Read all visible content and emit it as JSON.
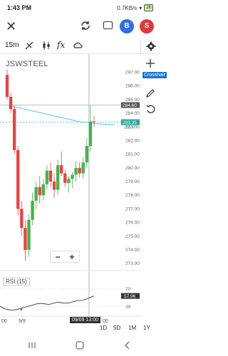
{
  "status": {
    "time": "1:43 PM",
    "net_speed": "0.7KB/s",
    "battery": "26"
  },
  "app_bar": {
    "avatar_b": "B",
    "avatar_s": "S"
  },
  "toolbar": {
    "interval": "15m"
  },
  "tooltip": {
    "crosshair": "Crosshair"
  },
  "chart": {
    "symbol": "JSWSTEEL",
    "price_axis": [
      "287.00",
      "286.00",
      "285.00",
      "284.00",
      "283.00",
      "282.00",
      "281.00",
      "280.00",
      "279.00",
      "278.00",
      "277.00",
      "276.00",
      "275.00",
      "274.00",
      "273.00"
    ],
    "price_tag_last": "284.60",
    "price_tag_current": "283.35",
    "price_tag_small": "283.17",
    "rsi_label": "RSI (15)",
    "rsi_axis": [
      "70",
      "39"
    ],
    "rsi_tag": "57.96",
    "time_labels": {
      "left": "00",
      "mid": "9/9",
      "right": ":00"
    },
    "crosshair_time": "09/09 13:00",
    "zoom_minus": "−",
    "zoom_plus": "+"
  },
  "chart_data": {
    "type": "candlestick",
    "title": "JSWSTEEL",
    "interval": "15m",
    "ylim": [
      272.8,
      287.6
    ],
    "candles": [
      {
        "o": 286.8,
        "h": 287.2,
        "l": 285.0,
        "c": 285.2
      },
      {
        "o": 285.2,
        "h": 285.5,
        "l": 284.0,
        "c": 284.3
      },
      {
        "o": 284.3,
        "h": 284.6,
        "l": 281.0,
        "c": 281.3
      },
      {
        "o": 281.3,
        "h": 281.6,
        "l": 276.5,
        "c": 277.0
      },
      {
        "o": 277.0,
        "h": 277.6,
        "l": 275.0,
        "c": 275.6
      },
      {
        "o": 275.6,
        "h": 276.2,
        "l": 273.2,
        "c": 274.0
      },
      {
        "o": 274.0,
        "h": 276.6,
        "l": 273.5,
        "c": 276.2
      },
      {
        "o": 276.2,
        "h": 278.2,
        "l": 275.8,
        "c": 277.6
      },
      {
        "o": 277.6,
        "h": 279.0,
        "l": 277.0,
        "c": 278.6
      },
      {
        "o": 278.6,
        "h": 279.4,
        "l": 277.4,
        "c": 278.0
      },
      {
        "o": 278.0,
        "h": 279.2,
        "l": 277.6,
        "c": 278.8
      },
      {
        "o": 278.8,
        "h": 280.2,
        "l": 278.4,
        "c": 279.8
      },
      {
        "o": 279.8,
        "h": 280.4,
        "l": 278.6,
        "c": 279.0
      },
      {
        "o": 279.0,
        "h": 279.6,
        "l": 277.8,
        "c": 278.4
      },
      {
        "o": 278.4,
        "h": 280.6,
        "l": 278.0,
        "c": 280.2
      },
      {
        "o": 280.2,
        "h": 281.2,
        "l": 279.4,
        "c": 279.6
      },
      {
        "o": 279.6,
        "h": 279.9,
        "l": 278.6,
        "c": 278.9
      },
      {
        "o": 278.9,
        "h": 279.4,
        "l": 278.2,
        "c": 279.2
      },
      {
        "o": 279.2,
        "h": 279.7,
        "l": 278.5,
        "c": 279.5
      },
      {
        "o": 279.5,
        "h": 280.5,
        "l": 279.0,
        "c": 280.0
      },
      {
        "o": 280.0,
        "h": 280.4,
        "l": 279.3,
        "c": 279.6
      },
      {
        "o": 279.6,
        "h": 280.8,
        "l": 279.2,
        "c": 280.4
      },
      {
        "o": 280.4,
        "h": 282.2,
        "l": 280.0,
        "c": 281.6
      },
      {
        "o": 281.6,
        "h": 284.6,
        "l": 281.2,
        "c": 283.4
      },
      {
        "o": 283.4,
        "h": 283.8,
        "l": 283.0,
        "c": 283.35
      }
    ],
    "ma_line": [
      284.6,
      284.4,
      284.2,
      284.0,
      283.8,
      283.6,
      283.4,
      283.3,
      283.2,
      283.17
    ],
    "rsi": [
      40,
      36,
      34,
      33,
      34,
      36,
      38,
      40,
      42,
      44,
      45,
      44,
      43,
      45,
      47,
      46,
      45,
      46,
      48,
      50,
      50,
      52,
      55,
      57.96
    ]
  },
  "range_buttons": [
    "1D",
    "5D",
    "1M",
    "1Y"
  ]
}
